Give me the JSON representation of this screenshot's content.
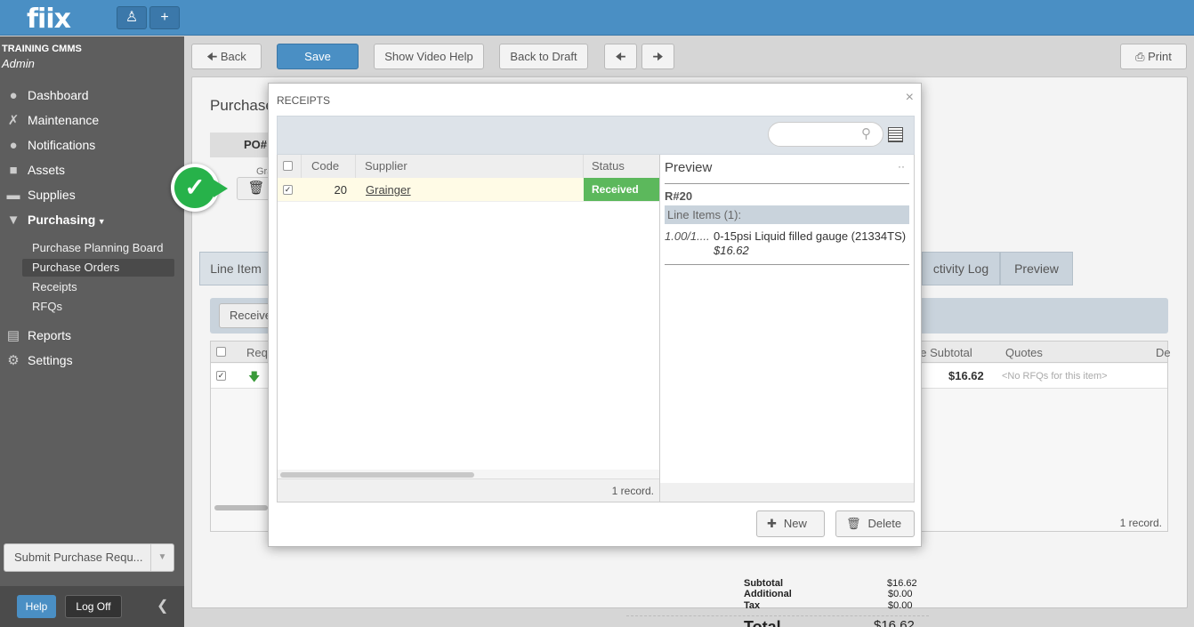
{
  "app": {
    "logo": "fiix",
    "user_icon": "user-icon",
    "add_icon": "plus-icon"
  },
  "sidebar": {
    "org": "TRAINING CMMS",
    "role": "Admin",
    "items": [
      {
        "label": "Dashboard",
        "icon": "dashboard-icon"
      },
      {
        "label": "Maintenance",
        "icon": "tools-icon"
      },
      {
        "label": "Notifications",
        "icon": "chat-icon"
      },
      {
        "label": "Assets",
        "icon": "box-icon"
      },
      {
        "label": "Supplies",
        "icon": "truck-icon"
      },
      {
        "label": "Purchasing",
        "icon": "cart-icon"
      },
      {
        "label": "Reports",
        "icon": "chart-icon"
      },
      {
        "label": "Settings",
        "icon": "gear-icon"
      }
    ],
    "purchasing_sub": [
      "Purchase Planning Board",
      "Purchase Orders",
      "Receipts",
      "RFQs"
    ],
    "submit_label": "Submit Purchase Requ...",
    "help_label": "Help",
    "logoff_label": "Log Off"
  },
  "toolbar": {
    "back": "Back",
    "save": "Save",
    "video_help": "Show Video Help",
    "back_to_draft": "Back to Draft",
    "print": "Print"
  },
  "page": {
    "title": "Purchase",
    "po_label": "PO#",
    "gr_fragment": "Gra",
    "tabs": [
      "Line Item",
      "ctivity Log",
      "Preview"
    ],
    "receive_btn": "Receive",
    "grid_cols": [
      "Requ",
      "ne Subtotal",
      "Quotes",
      "De"
    ],
    "grid_row_subtotal": "$16.62",
    "grid_row_quotes": "<No RFQs for this item>",
    "grid_record_count": "1 record.",
    "subtotal_label": "Subtotal",
    "subtotal_value": "$16.62",
    "additional_label": "Additional",
    "additional_value": "$0.00",
    "tax_label": "Tax",
    "tax_value": "$0.00",
    "total_label": "Total",
    "total_value": "$16.62"
  },
  "modal": {
    "title": "RECEIPTS",
    "close": "×",
    "search_placeholder": "",
    "columns": {
      "code": "Code",
      "supplier": "Supplier",
      "status": "Status"
    },
    "rows": [
      {
        "code": "20",
        "supplier": "Grainger",
        "status": "Received",
        "checked": true
      }
    ],
    "record_count": "1 record.",
    "preview": {
      "title": "Preview",
      "dots": "··",
      "code": "R#20",
      "line_items_header": "Line Items (1):",
      "qty": "1.00/1....",
      "item": "0-15psi Liquid filled gauge (21334TS)",
      "price": "$16.62"
    },
    "new_label": "New",
    "delete_label": "Delete"
  },
  "colors": {
    "accent": "#4a8fc4",
    "received": "#5cb85c",
    "callout": "#27b24a"
  }
}
